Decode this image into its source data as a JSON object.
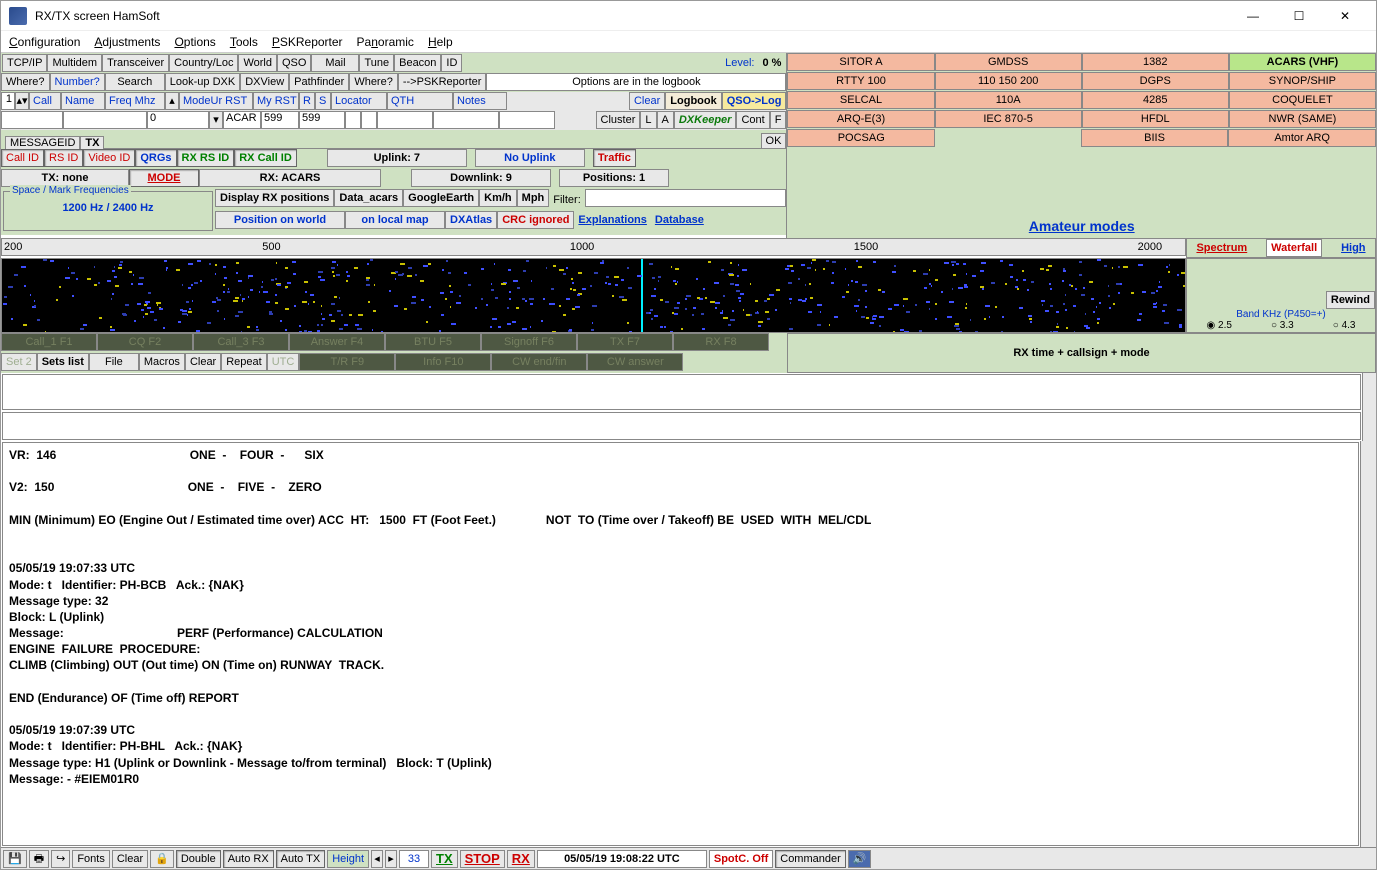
{
  "window": {
    "title": "RX/TX screen  HamSoft"
  },
  "menu": [
    "Configuration",
    "Adjustments",
    "Options",
    "Tools",
    "PSKReporter",
    "Panoramic",
    "Help"
  ],
  "toolbar1": [
    "TCP/IP",
    "Multidem",
    "Transceiver",
    "Country/Loc",
    "World",
    "QSO",
    "Mail",
    "Tune",
    "Beacon",
    "ID"
  ],
  "level": {
    "label": "Level:",
    "value": "0 %"
  },
  "lookup_row": {
    "btns": [
      "Where?",
      "Number?",
      "Search",
      "Look-up DXK",
      "DXView",
      "Pathfinder",
      "Where?",
      "-->PSKReporter"
    ],
    "note": "Options are in the logbook"
  },
  "grid_headers": [
    "Call",
    "Name",
    "Freq Mhz",
    "ModeUr RST",
    "My RST",
    "R",
    "S",
    "Locator",
    "QTH",
    "Notes"
  ],
  "grid_row": {
    "num": "1",
    "freq": "0",
    "mode": "ACAR",
    "ur_rst": "599",
    "my_rst": "599"
  },
  "log_btns": [
    "Clear",
    "Logbook",
    "QSO->Log"
  ],
  "cluster_btns": [
    "Cluster",
    "L",
    "A",
    "DXKeeper",
    "Cont",
    "F"
  ],
  "msgtab": {
    "label": "MESSAGEID",
    "tx": "TX",
    "ok": "OK"
  },
  "idrow": {
    "buttons": [
      "Call ID",
      "RS ID",
      "Video ID",
      "QRGs",
      "RX RS ID",
      "RX Call ID"
    ],
    "tx": "TX: none",
    "mode": "MODE",
    "rx": "RX: ACARS",
    "uplink": "Uplink: 7",
    "downlink": "Downlink: 9",
    "nouplink": "No Uplink",
    "positions": "Positions: 1",
    "traffic": "Traffic"
  },
  "freqbox": {
    "legend": "Space / Mark Frequencies",
    "value": "1200 Hz / 2400 Hz"
  },
  "tools2": {
    "row1": [
      "Display RX positions",
      "Data_acars",
      "GoogleEarth",
      "Km/h",
      "Mph"
    ],
    "filter": "Filter:",
    "row2": [
      "Position on world",
      "on local map",
      "DXAtlas",
      "CRC ignored",
      "Explanations",
      "Database"
    ]
  },
  "scale_ticks": [
    "200",
    "500",
    "1000",
    "1500",
    "2000"
  ],
  "modes": [
    [
      "SITOR A",
      "GMDSS",
      "1382",
      "ACARS (VHF)"
    ],
    [
      "RTTY 100",
      "110 150 200",
      "DGPS",
      "SYNOP/SHIP"
    ],
    [
      "SELCAL",
      "110A",
      "4285",
      "COQUELET"
    ],
    [
      "ARQ-E(3)",
      "IEC 870-5",
      "HFDL",
      "NWR (SAME)"
    ],
    [
      "POCSAG",
      "",
      "BIIS",
      "Amtor ARQ"
    ]
  ],
  "amateur": "Amateur modes",
  "spectrum_tabs": [
    "Spectrum",
    "Waterfall",
    "High"
  ],
  "rewind": "Rewind",
  "band_label": "Band KHz (P450=+)",
  "band_opts": [
    "2.5",
    "3.3",
    "4.3"
  ],
  "macro_row1": [
    "Call_1  F1",
    "CQ        F2",
    "Call_3  F3",
    "Answer  F4",
    "BTU       F5",
    "Signoff F6",
    "TX        F7",
    "RX        F8"
  ],
  "macro_row2": [
    "Set 2",
    "Sets list",
    "File",
    "Macros",
    "Clear",
    "Repeat",
    "UTC",
    "T/R       F9",
    "Info  F10",
    "CW end/fin",
    "CW answer"
  ],
  "rx_banner": "RX time + callsign + mode",
  "rxtext": "VR:  146                                        ONE  -    FOUR  -      SIX\n\nV2:  150                                        ONE  -    FIVE  -    ZERO\n\nMIN (Minimum) EO (Engine Out / Estimated time over) ACC  HT:   1500  FT (Foot Feet.)               NOT  TO (Time over / Takeoff) BE  USED  WITH  MEL/CDL\n\n\n05/05/19 19:07:33 UTC\nMode: t   Identifier: PH-BCB   Ack.: {NAK}\nMessage type: 32\nBlock: L (Uplink)\nMessage:                                  PERF (Performance) CALCULATION\nENGINE  FAILURE  PROCEDURE:\nCLIMB (Climbing) OUT (Out time) ON (Time on) RUNWAY  TRACK.\n\nEND (Endurance) OF (Time off) REPORT\n\n05/05/19 19:07:39 UTC\nMode: t   Identifier: PH-BHL   Ack.: {NAK}\nMessage type: H1 (Uplink or Downlink - Message to/from terminal)   Block: T (Uplink)\nMessage: - #EIEM01R0",
  "status": {
    "fonts": "Fonts",
    "clear": "Clear",
    "double": "Double",
    "autorx": "Auto RX",
    "autotx": "Auto TX",
    "height": "Height",
    "height_val": "33",
    "tx": "TX",
    "stop": "STOP",
    "rx": "RX",
    "clock": "05/05/19 19:08:22 UTC",
    "spot": "SpotC. Off",
    "commander": "Commander"
  }
}
